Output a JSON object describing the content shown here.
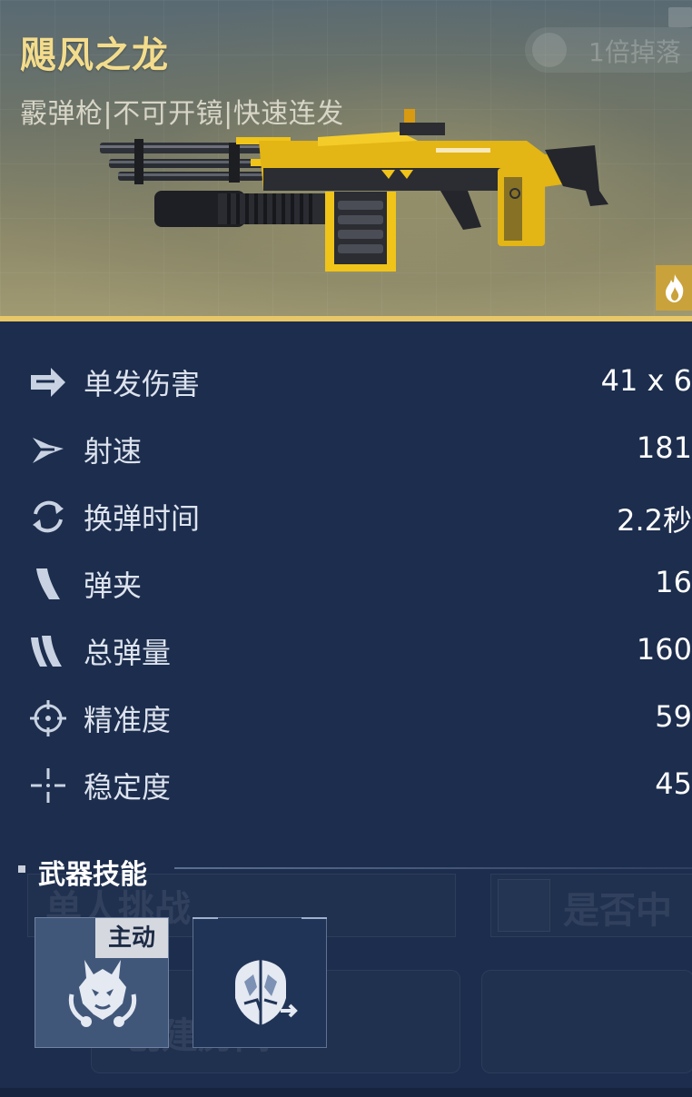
{
  "weapon": {
    "name": "飓风之龙",
    "tags": "霰弹枪|不可开镜|快速连发"
  },
  "header": {
    "ghost_badge": "1倍掉落"
  },
  "stats": [
    {
      "icon": "arrow-right-icon",
      "label": "单发伤害",
      "value": "41 x 6"
    },
    {
      "icon": "speed-arrow-icon",
      "label": "射速",
      "value": "181"
    },
    {
      "icon": "reload-cycle-icon",
      "label": "换弹时间",
      "value": "2.2秒"
    },
    {
      "icon": "magazine-icon",
      "label": "弹夹",
      "value": "16"
    },
    {
      "icon": "ammo-total-icon",
      "label": "总弹量",
      "value": "160"
    },
    {
      "icon": "crosshair-icon",
      "label": "精准度",
      "value": "59"
    },
    {
      "icon": "stability-icon",
      "label": "稳定度",
      "value": "45"
    }
  ],
  "skills": {
    "title": "武器技能",
    "items": [
      {
        "tag": "主动",
        "icon": "dragon-head-icon",
        "active": true
      },
      {
        "tag": "",
        "icon": "dragon-shield-icon",
        "active": false
      }
    ]
  },
  "ghost_ui": {
    "left_text": "单人挑战",
    "right_text": "是否中",
    "create_room": "创建房间"
  },
  "colors": {
    "accent_gold": "#e7c768",
    "title_gold": "#f3dc8c",
    "panel_bg": "#1c2d4d"
  }
}
